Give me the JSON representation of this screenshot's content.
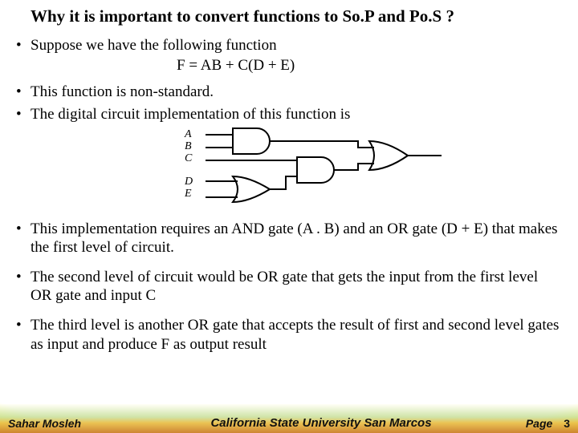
{
  "title": "Why it is important to convert functions to So.P and Po.S ?",
  "bullets": {
    "b1": "Suppose we have the following function",
    "formula": "F = AB + C(D + E)",
    "b2": "This function is non-standard.",
    "b3": "The digital circuit implementation of this function is",
    "b4": "This implementation requires an AND gate (A . B) and an OR gate (D + E) that makes the first level of circuit.",
    "b5": "The second level of circuit would be OR gate that gets the input from the first level OR gate and input C",
    "b6": "The third level is another OR gate that accepts the result of first and second level gates as input and produce F as output result"
  },
  "diagram": {
    "inputs": {
      "A": "A",
      "B": "B",
      "C": "C",
      "D": "D",
      "E": "E"
    }
  },
  "footer": {
    "author": "Sahar Mosleh",
    "university": "California State University San Marcos",
    "page_label": "Page",
    "page_number": "3"
  }
}
